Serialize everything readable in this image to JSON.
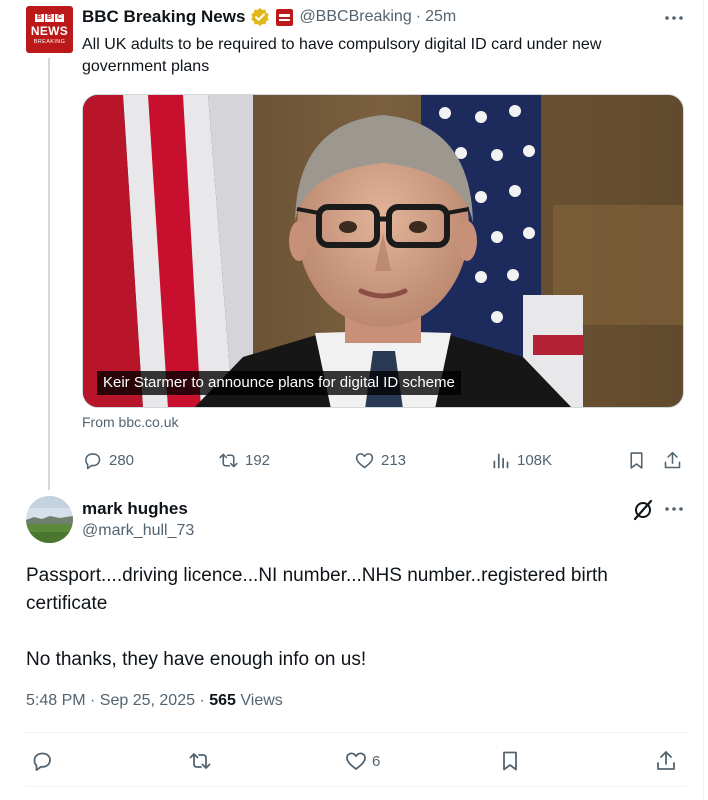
{
  "original_tweet": {
    "avatar": {
      "line1": [
        "B",
        "B",
        "C"
      ],
      "line2": "NEWS",
      "line3": "BREAKING"
    },
    "author_name": "BBC Breaking News",
    "handle": "@BBCBreaking",
    "separator": "·",
    "time": "25m",
    "text": "All UK adults to be required to have compulsory digital ID card under new government plans",
    "media": {
      "caption": "Keir Starmer to announce plans for digital ID scheme"
    },
    "link_source": "From bbc.co.uk",
    "metrics": {
      "replies": "280",
      "reposts": "192",
      "likes": "213",
      "views": "108K"
    }
  },
  "reply": {
    "author_name": "mark hughes",
    "handle": "@mark_hull_73",
    "paragraphs": [
      "Passport....driving licence...NI number...NHS number..registered birth certificate",
      "No thanks, they have enough info on us!"
    ],
    "timestamp": "5:48 PM · Sep 25, 2025",
    "meta_separator": "·",
    "views_count": "565",
    "views_label": "Views",
    "metrics": {
      "likes": "6"
    }
  },
  "colors": {
    "bbc_red": "#bb1919",
    "verified_gold": "#e2b719",
    "text_primary": "#0f1419",
    "text_secondary": "#536471",
    "divider": "#eff3f4"
  },
  "icons": [
    "verified-badge-icon",
    "more-icon",
    "reply-icon",
    "repost-icon",
    "like-icon",
    "views-icon",
    "bookmark-icon",
    "share-icon",
    "grok-icon"
  ]
}
